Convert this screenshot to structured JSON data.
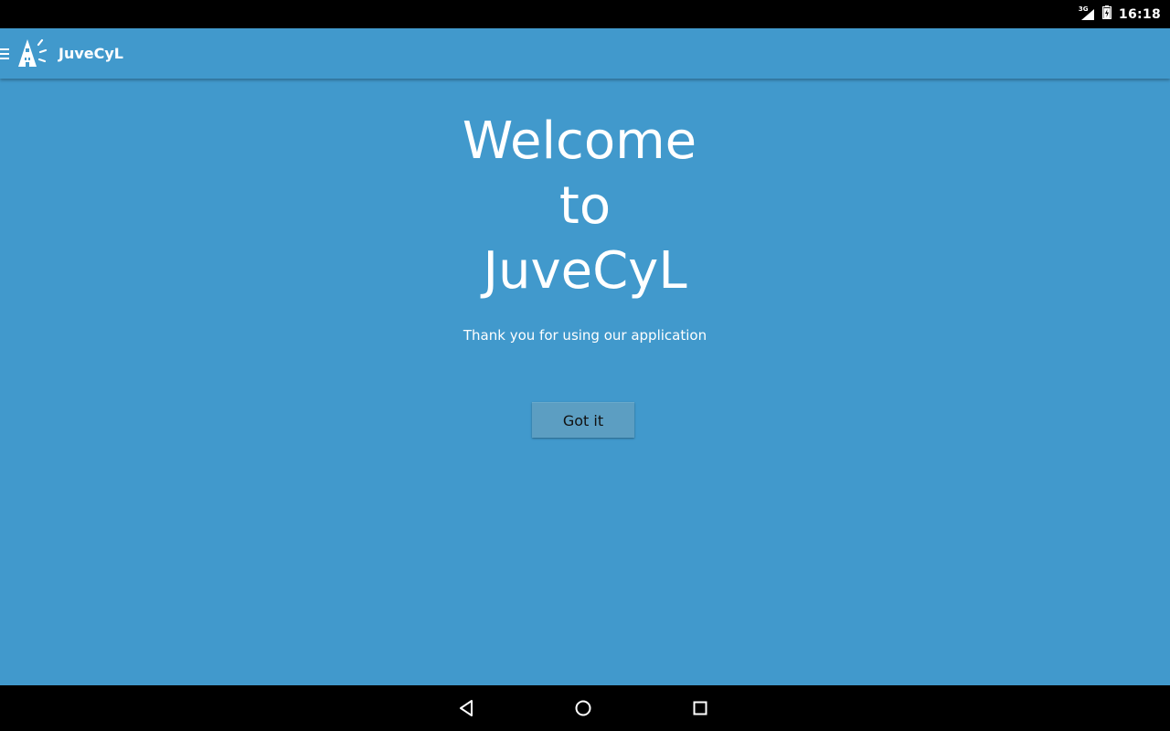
{
  "status_bar": {
    "network_type": "3G",
    "time": "16:18",
    "icons": [
      "signal-icon",
      "battery-icon"
    ]
  },
  "app_bar": {
    "title": "JuveCyL",
    "icons": [
      "menu-icon",
      "app-logo-icon"
    ]
  },
  "main": {
    "welcome_lines": [
      "Welcome",
      "to",
      "JuveCyL"
    ],
    "subtitle": "Thank you for using our application",
    "button_label": "Got it"
  },
  "nav_bar": {
    "icons": [
      "back-icon",
      "home-icon",
      "recents-icon"
    ]
  },
  "colors": {
    "accent": "#4199cc",
    "button": "#5c9ec2",
    "system_bars": "#000000",
    "text": "#ffffff"
  }
}
